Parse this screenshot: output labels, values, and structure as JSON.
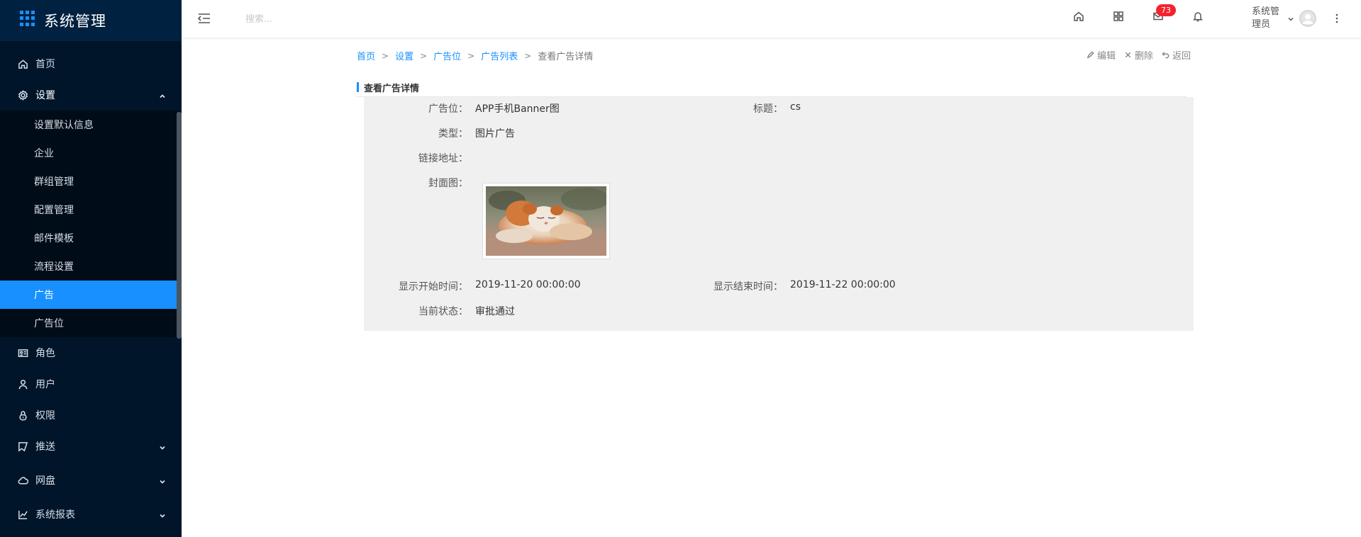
{
  "app": {
    "title": "系统管理"
  },
  "sidebar": {
    "items": [
      {
        "label": "首页",
        "icon": "home-icon"
      },
      {
        "label": "设置",
        "icon": "gear-icon",
        "expanded": true
      },
      {
        "label": "角色",
        "icon": "id-card-icon"
      },
      {
        "label": "用户",
        "icon": "user-icon"
      },
      {
        "label": "权限",
        "icon": "lock-icon"
      },
      {
        "label": "推送",
        "icon": "send-icon"
      },
      {
        "label": "网盘",
        "icon": "cloud-icon"
      },
      {
        "label": "系统报表",
        "icon": "line-chart-icon"
      }
    ],
    "settings_sub": [
      {
        "label": "设置默认信息"
      },
      {
        "label": "企业"
      },
      {
        "label": "群组管理"
      },
      {
        "label": "配置管理"
      },
      {
        "label": "邮件模板"
      },
      {
        "label": "流程设置"
      },
      {
        "label": "广告",
        "active": true
      },
      {
        "label": "广告位"
      }
    ]
  },
  "header": {
    "search_placeholder": "搜索...",
    "mail_badge": "73",
    "username": "系统管理员",
    "icons": [
      "menu-fold-icon",
      "home-icon",
      "apps-icon",
      "mail-icon",
      "bell-icon",
      "more-icon"
    ]
  },
  "breadcrumb": {
    "items": [
      "首页",
      "设置",
      "广告位",
      "广告列表"
    ],
    "current": "查看广告详情",
    "separator": ">"
  },
  "actions": {
    "edit": "编辑",
    "delete": "删除",
    "back": "返回"
  },
  "section": {
    "title": "查看广告详情"
  },
  "detail": {
    "position_label": "广告位：",
    "position_value": "APP手机Banner图",
    "title_label": "标题：",
    "title_value": "cs",
    "type_label": "类型：",
    "type_value": "图片广告",
    "link_label": "链接地址：",
    "link_value": "",
    "cover_label": "封面图：",
    "start_label": "显示开始时间：",
    "start_value": "2019-11-20 00:00:00",
    "end_label": "显示结束时间：",
    "end_value": "2019-11-22 00:00:00",
    "status_label": "当前状态：",
    "status_value": "审批通过"
  },
  "colors": {
    "sidebar_bg": "#001529",
    "accent": "#1890ff",
    "badge": "#f5222d",
    "panel_bg": "#f0f0f0"
  }
}
